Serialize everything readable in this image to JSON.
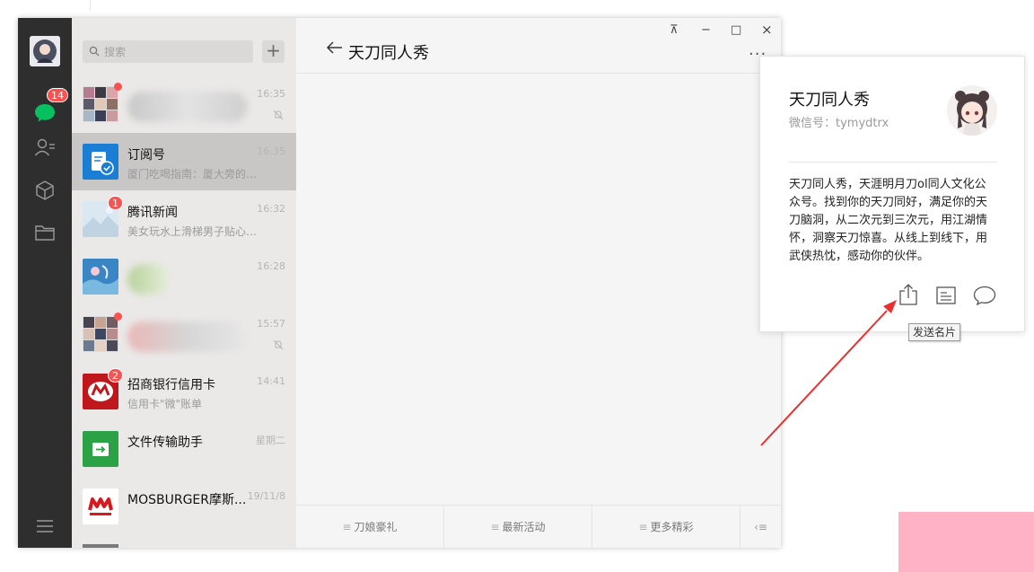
{
  "nav": {
    "chat_badge": "14"
  },
  "search": {
    "placeholder": "搜索",
    "add": "+"
  },
  "conversations": [
    {
      "name": "",
      "sub": "",
      "time": "16:35"
    },
    {
      "name": "订阅号",
      "sub": "厦门吃喝指南：厦大旁的…",
      "time": "16:35"
    },
    {
      "name": "腾讯新闻",
      "sub": "美女玩水上滑梯男子贴心…",
      "time": "16:32",
      "badge": "1"
    },
    {
      "name": "",
      "sub": "",
      "time": "16:28"
    },
    {
      "name": "",
      "sub": "",
      "time": "15:57"
    },
    {
      "name": "招商银行信用卡",
      "sub": "信用卡\"微\"账单",
      "time": "14:41",
      "badge": "2"
    },
    {
      "name": "文件传输助手",
      "sub": "",
      "time": "星期二"
    },
    {
      "name": "MOSBURGER摩斯...",
      "sub": "",
      "time": "19/11/8"
    }
  ],
  "chat": {
    "title": "天刀同人秀",
    "back": "←",
    "more": "···",
    "menu": [
      "刀娘豪礼",
      "最新活动",
      "更多精彩"
    ],
    "menu_icon": "≡",
    "collapse": "‹≡"
  },
  "window_controls": {
    "pin": "⊼",
    "minimize": "−",
    "maximize": "□",
    "close": "×"
  },
  "card": {
    "name": "天刀同人秀",
    "wxid": "微信号：tymydtrx",
    "desc": "天刀同人秀，天涯明月刀ol同人文化公众号。找到你的天刀同好，满足你的天刀脑洞，从二次元到三次元，用江湖情怀，洞察天刀惊喜。从线上到线下，用武侠热忱，感动你的伙伴。",
    "tooltip": "发送名片"
  },
  "colors": {
    "accent_green": "#07c160",
    "badge_red": "#fa5151",
    "arrow_red": "#e8302f",
    "nav_dark": "#2e2e2e"
  }
}
